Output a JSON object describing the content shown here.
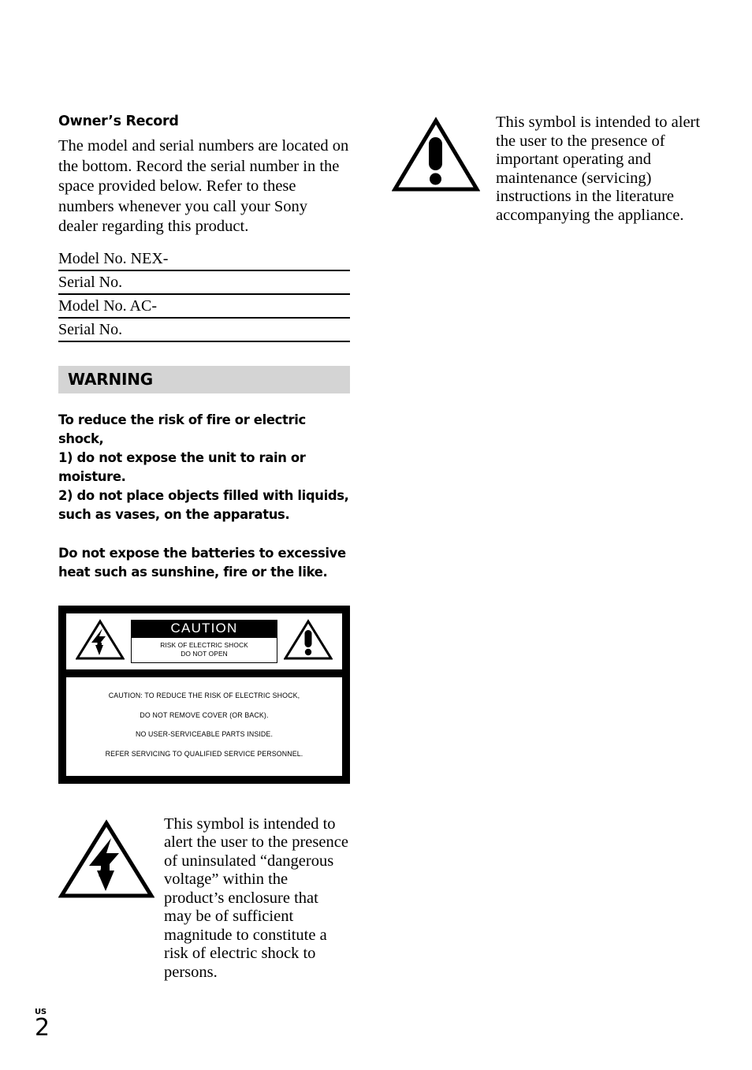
{
  "page": {
    "locale_label": "US",
    "page_number": "2",
    "bar_color": "#d4d4d4"
  },
  "owners_record": {
    "heading": "Owner’s Record",
    "body": "The model and serial numbers are located on the bottom. Record the serial number in the space provided below. Refer to these numbers whenever you call your Sony dealer regarding this product.",
    "fields": [
      "Model No. NEX-",
      "Serial No.",
      "Model No. AC-",
      "Serial No."
    ]
  },
  "warning": {
    "title": "WARNING",
    "paragraph_1": "To reduce the risk of fire or electric shock,\n1) do not expose the unit to rain or moisture.\n2) do not place objects filled with liquids, such as vases, on the apparatus.",
    "paragraph_2": "Do not expose the batteries to excessive heat such as sunshine, fire or the like."
  },
  "caution_box": {
    "title": "CAUTION",
    "subtitle": "RISK OF ELECTRIC SHOCK\nDO NOT OPEN",
    "lines": [
      "CAUTION: TO REDUCE THE RISK OF ELECTRIC SHOCK,",
      "DO NOT REMOVE COVER (OR BACK).",
      "NO USER-SERVICEABLE PARTS INSIDE.",
      "REFER SERVICING TO QUALIFIED SERVICE PERSONNEL."
    ],
    "left_icon": "lightning-bolt-triangle-icon",
    "right_icon": "exclamation-triangle-icon"
  },
  "symbol_notes": {
    "lightning": {
      "icon": "lightning-bolt-triangle-icon",
      "text": "This symbol is intended to alert the user to the presence of uninsulated “dangerous voltage” within the product’s enclosure that may be of sufficient magnitude to constitute a risk of electric shock to persons."
    },
    "exclamation": {
      "icon": "exclamation-triangle-icon",
      "text": "This symbol is intended to alert the user to the presence of important operating and maintenance (servicing) instructions in the literature accompanying the appliance."
    }
  }
}
